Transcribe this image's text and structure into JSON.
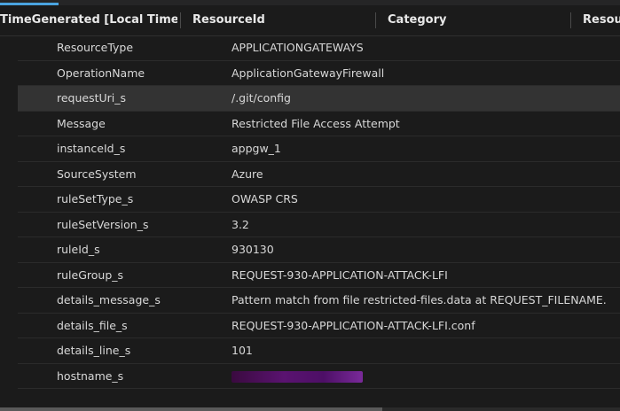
{
  "columns": [
    {
      "label": "TimeGenerated [Local Time]"
    },
    {
      "label": "ResourceId"
    },
    {
      "label": "Category"
    },
    {
      "label": "Resour"
    }
  ],
  "rows": [
    {
      "key": "ResourceType",
      "value": "APPLICATIONGATEWAYS"
    },
    {
      "key": "OperationName",
      "value": "ApplicationGatewayFirewall"
    },
    {
      "key": "requestUri_s",
      "value": "/.git/config"
    },
    {
      "key": "Message",
      "value": "Restricted File Access Attempt"
    },
    {
      "key": "instanceId_s",
      "value": "appgw_1"
    },
    {
      "key": "SourceSystem",
      "value": "Azure"
    },
    {
      "key": "ruleSetType_s",
      "value": "OWASP CRS"
    },
    {
      "key": "ruleSetVersion_s",
      "value": "3.2"
    },
    {
      "key": "ruleId_s",
      "value": "930130"
    },
    {
      "key": "ruleGroup_s",
      "value": "REQUEST-930-APPLICATION-ATTACK-LFI"
    },
    {
      "key": "details_message_s",
      "value": "Pattern match from file restricted-files.data at REQUEST_FILENAME."
    },
    {
      "key": "details_file_s",
      "value": "REQUEST-930-APPLICATION-ATTACK-LFI.conf"
    },
    {
      "key": "details_line_s",
      "value": "101"
    },
    {
      "key": "hostname_s",
      "value": ""
    }
  ],
  "selected_row": "requestUri_s",
  "colors": {
    "background": "#1b1b1b",
    "selected_row": "#333333",
    "accent": "#4aa3df",
    "redaction": "#5a1370"
  }
}
